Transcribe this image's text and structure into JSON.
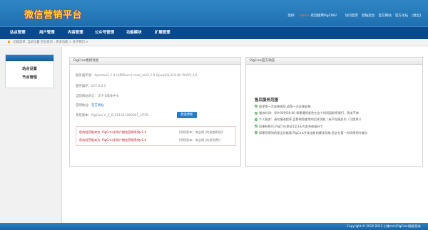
{
  "header": {
    "logo": "微信营销平台",
    "user_label": "您好：",
    "username": "admin",
    "welcome": "欢迎使用PigCMS!",
    "links": [
      "访问首页",
      "登陆后台",
      "官方网站",
      "官方论坛",
      "[退出]"
    ]
  },
  "nav": {
    "items": [
      "站点管理",
      "用户管理",
      "内容管理",
      "公众号管理",
      "功能模块",
      "扩展管理"
    ]
  },
  "breadcrumb": {
    "text": "功能菜单: 当前位置 后台首页 , 更多功能 > 关于我们 >"
  },
  "sidebar": {
    "items": [
      "站点设置",
      "节点管理"
    ]
  },
  "left_panel": {
    "title": "PigCms更新消息",
    "rows": {
      "env": {
        "label": "服务器环境：",
        "value": "Apache/2.2.9 (APMServ) mod_ssl/2.2.9 OpenSSL/0.9.8h PHP/5.2.6"
      },
      "ip": {
        "label": "服务器IP：",
        "value": "127.0.0.1"
      },
      "lang": {
        "label": "当前网站语言：",
        "value": "UTF-8简体中文"
      },
      "site": {
        "label": "官网地址：",
        "value": "官方网站"
      },
      "version": {
        "label": "系统版本：",
        "value": "PigCms V_5_0_201311260001_UTF8"
      }
    },
    "update_button": "检查更新",
    "license": [
      {
        "red": "您的程序版本为: PigCms多用户微信营销系统v2.0",
        "gray": "[授权版本：商业版 (终身使用权)]"
      },
      {
        "red": "您的程序版本为: PigCms多用户微信营销系统v2.0",
        "gray": "[授权版本：商业版 (终身免费)]"
      }
    ]
  },
  "right_panel": {
    "title": "PigCms官方动态",
    "service_title": "售后服务范围",
    "services": [
      "程序第一次安装指导,或第一次迁移安装",
      "服务时间：早9:00到18:00 如果遇到紧急在这个时间段联系我们，周末不休",
      "个人服务：请勿擅改程序,会影响您使用的后续功能（有不在服务内（可提供））",
      "如果有BUG,PigCms承诺1至3天内发布修复补丁",
      "如果您得到的是全功能版,PigCms开发出新的模块功能,您会在第一时间得到升级包"
    ]
  },
  "footer": {
    "text": "Copyright © 2012-2013 小猪cms(PigCms)版权所有"
  },
  "colors": {
    "header_blue": "#1f6fb0",
    "nav_dark_blue": "#0a4a8c",
    "logo_yellow": "#ffd23c",
    "alert_red": "#c8161d",
    "link_blue": "#2b76c6"
  }
}
